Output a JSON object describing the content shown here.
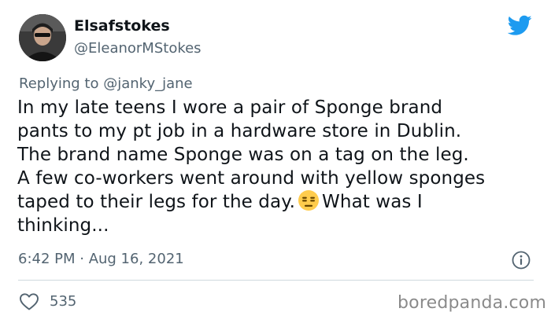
{
  "tweet": {
    "author": {
      "display_name": "Elsafstokes",
      "handle": "@EleanorMStokes"
    },
    "reply": {
      "prefix": "Replying to",
      "mention": "@janky_jane"
    },
    "body": {
      "line1": "In my late teens I wore a pair of Sponge brand",
      "line2": "pants to my pt job in a hardware store in Dublin.",
      "line3": "The brand name Sponge was on a tag on the leg.",
      "line4": "A few co-workers went around with yellow sponges",
      "line5_before_emoji": "taped to their legs for the day.",
      "line5_after_emoji": "What was I",
      "line6": "thinking..."
    },
    "emoji_name": "expressionless-face",
    "timestamp": "6:42 PM · Aug 16, 2021",
    "likes": "535"
  },
  "icons": {
    "platform": "twitter-bird-icon",
    "info": "info-icon",
    "like": "heart-icon"
  },
  "colors": {
    "brand": "#1d9bf0",
    "text_primary": "#0f1419",
    "text_secondary": "#536471",
    "divider": "#cfd9de",
    "emoji": "#ffcc4d",
    "watermark": "#8a8a8a"
  },
  "watermark": "boredpanda.com"
}
